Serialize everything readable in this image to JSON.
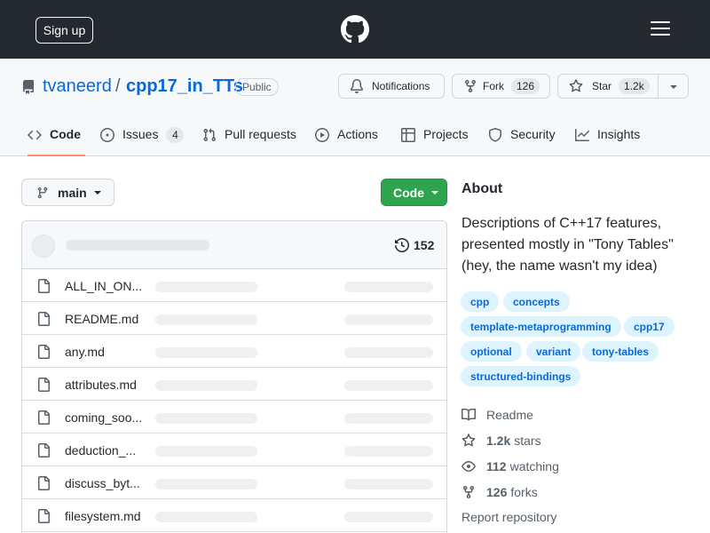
{
  "header": {
    "signup_label": "Sign up"
  },
  "repo": {
    "owner": "tvaneerd",
    "separator": "/",
    "name": "cpp17_in_TTs",
    "visibility": "Public",
    "notifications_label": "Notifications",
    "fork_label": "Fork",
    "fork_count": "126",
    "star_label": "Star",
    "star_count": "1.2k"
  },
  "tabs": [
    {
      "label": "Code",
      "icon": "code-icon",
      "active": true
    },
    {
      "label": "Issues",
      "icon": "issue-opened-icon",
      "count": "4"
    },
    {
      "label": "Pull requests",
      "icon": "git-pull-request-icon"
    },
    {
      "label": "Actions",
      "icon": "play-icon"
    },
    {
      "label": "Projects",
      "icon": "table-icon"
    },
    {
      "label": "Security",
      "icon": "shield-icon"
    },
    {
      "label": "Insights",
      "icon": "graph-icon"
    }
  ],
  "toolbar": {
    "branch": "main",
    "code_label": "Code"
  },
  "files": {
    "commit_count": "152",
    "items": [
      {
        "name": "ALL_IN_ON...",
        "type": "file"
      },
      {
        "name": "README.md",
        "type": "file"
      },
      {
        "name": "any.md",
        "type": "file"
      },
      {
        "name": "attributes.md",
        "type": "file"
      },
      {
        "name": "coming_soo...",
        "type": "file"
      },
      {
        "name": "deduction_...",
        "type": "file"
      },
      {
        "name": "discuss_byt...",
        "type": "file"
      },
      {
        "name": "filesystem.md",
        "type": "file"
      }
    ]
  },
  "about": {
    "title": "About",
    "description": "Descriptions of C++17 features, presented mostly in \"Tony Tables\" (hey, the name wasn't my idea)",
    "topics": [
      "cpp",
      "concepts",
      "template-metaprogramming",
      "cpp17",
      "optional",
      "variant",
      "tony-tables",
      "structured-bindings"
    ],
    "readme_label": "Readme",
    "stars_count": "1.2k",
    "stars_label": "stars",
    "watching_count": "112",
    "watching_label": "watching",
    "forks_count": "126",
    "forks_label": "forks",
    "report_label": "Report repository"
  },
  "colors": {
    "header_bg": "#24292f",
    "link": "#0969da",
    "primary_button": "#2da44e",
    "active_tab_underline": "#fd8c73",
    "topic_bg": "#ddf4ff"
  }
}
